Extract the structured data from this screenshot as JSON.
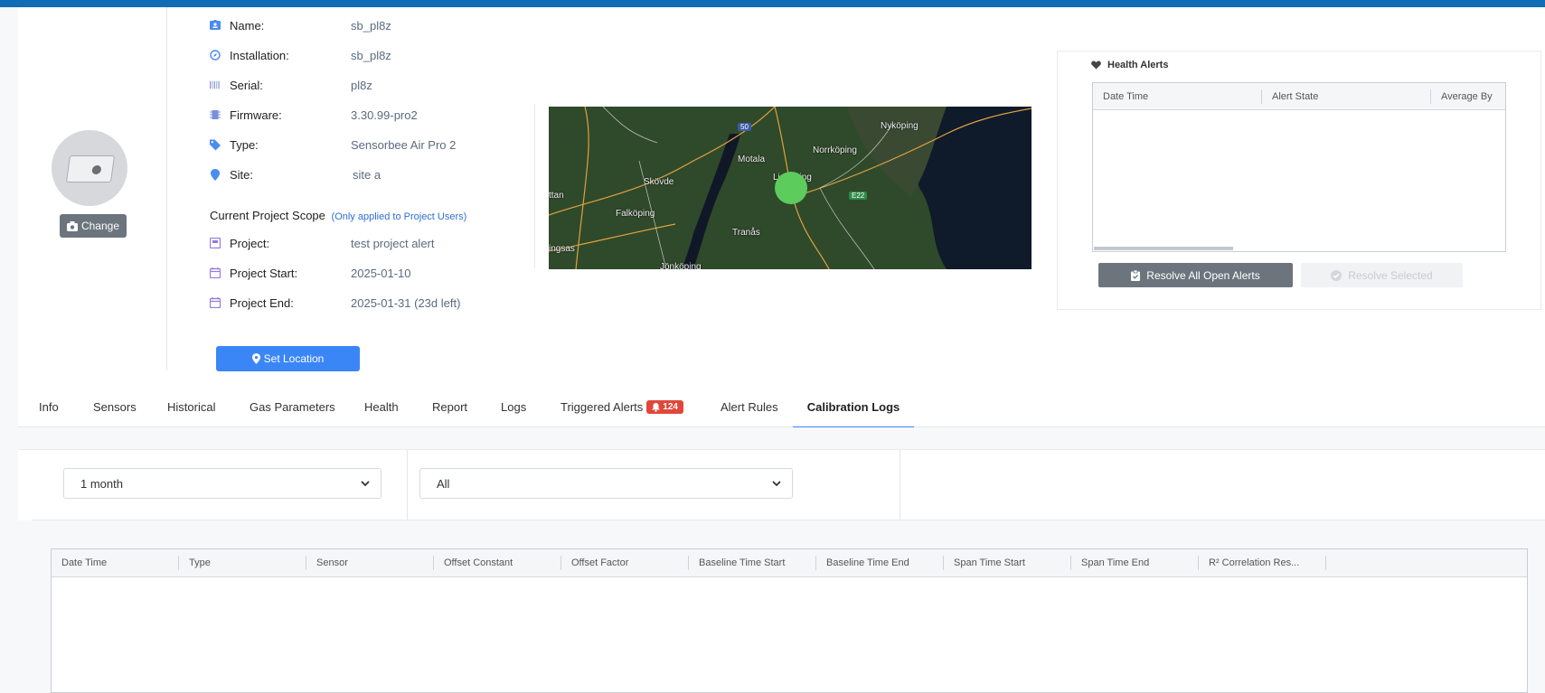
{
  "device": {
    "change_label": "Change",
    "fields": [
      {
        "label": "Name:",
        "value": "sb_pl8z"
      },
      {
        "label": "Installation:",
        "value": "sb_pl8z"
      },
      {
        "label": "Serial:",
        "value": "pl8z"
      },
      {
        "label": "Firmware:",
        "value": "3.30.99-pro2"
      },
      {
        "label": "Type:",
        "value": "Sensorbee Air Pro 2"
      },
      {
        "label": "Site:",
        "value": "site a"
      }
    ],
    "scope_title": "Current Project Scope",
    "scope_note": "(Only applied to Project Users)",
    "project_fields": [
      {
        "label": "Project:",
        "value": "test project alert"
      },
      {
        "label": "Project Start:",
        "value": "2025-01-10"
      },
      {
        "label": "Project End:",
        "value": "2025-01-31 (23d left)"
      }
    ],
    "set_location_label": "Set Location"
  },
  "map": {
    "labels": [
      "Nyköping",
      "Norrköping",
      "Motala",
      "Skövde",
      "Linköping",
      "Falköping",
      "Tranås",
      "Jönköping",
      "ttan",
      "ingsas"
    ],
    "shields": [
      "50",
      "E22"
    ]
  },
  "health_alerts": {
    "title": "Health Alerts",
    "columns": [
      "Date Time",
      "Alert State",
      "Average By"
    ],
    "resolve_all_label": "Resolve All Open Alerts",
    "resolve_selected_label": "Resolve Selected"
  },
  "tabs": {
    "items": [
      "Info",
      "Sensors",
      "Historical",
      "Gas Parameters",
      "Health",
      "Report",
      "Logs",
      "Triggered Alerts",
      "Alert Rules",
      "Calibration Logs"
    ],
    "triggered_count": "124",
    "active": "Calibration Logs"
  },
  "filters": {
    "period": "1 month",
    "type": "All"
  },
  "calibration_table": {
    "columns": [
      "Date Time",
      "Type",
      "Sensor",
      "Offset Constant",
      "Offset Factor",
      "Baseline Time Start",
      "Baseline Time End",
      "Span Time Start",
      "Span Time End",
      "R² Correlation Res..."
    ]
  },
  "colors": {
    "topbar": "#0f6db8",
    "primary": "#3a86f7",
    "secondary": "#6c757d",
    "badge": "#e0473a",
    "map_dot": "#5ccc5c"
  }
}
